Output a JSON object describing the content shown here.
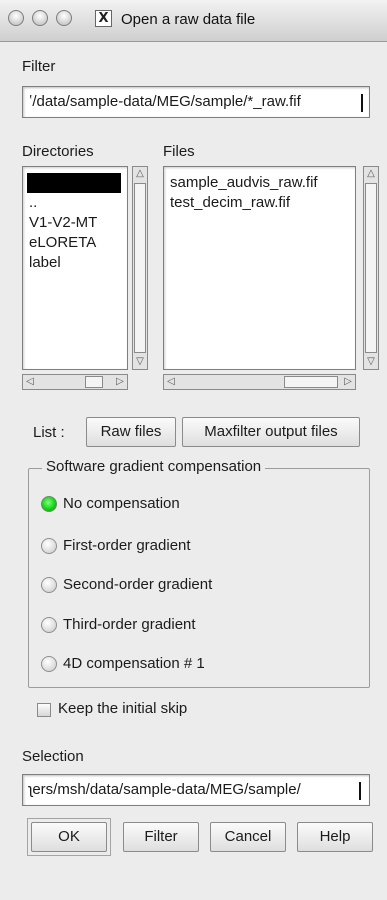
{
  "window": {
    "title": "Open a raw data file",
    "title_icon": "X"
  },
  "filter": {
    "label": "Filter",
    "value": "ʽ/data/sample-data/MEG/sample/*_raw.fif"
  },
  "directories": {
    "label": "Directories",
    "items": [
      "..",
      "V1-V2-MT",
      "eLORETA",
      "label"
    ]
  },
  "files": {
    "label": "Files",
    "items": [
      "sample_audvis_raw.fif",
      "test_decim_raw.fif"
    ]
  },
  "list": {
    "label": "List :",
    "raw_files": "Raw files",
    "maxfilter": "Maxfilter output files"
  },
  "compensation": {
    "title": "Software gradient compensation",
    "options": [
      "No compensation",
      "First-order gradient",
      "Second-order gradient",
      "Third-order gradient",
      "4D compensation # 1"
    ],
    "selected": "No compensation"
  },
  "keep_skip": {
    "label": "Keep the initial skip",
    "checked": false
  },
  "selection": {
    "label": "Selection",
    "value": "ʅers/msh/data/sample-data/MEG/sample/"
  },
  "buttons": {
    "ok": "OK",
    "filter": "Filter",
    "cancel": "Cancel",
    "help": "Help"
  },
  "colors": {
    "radio_selected": "#10d010",
    "selection_bg": "#000000"
  }
}
